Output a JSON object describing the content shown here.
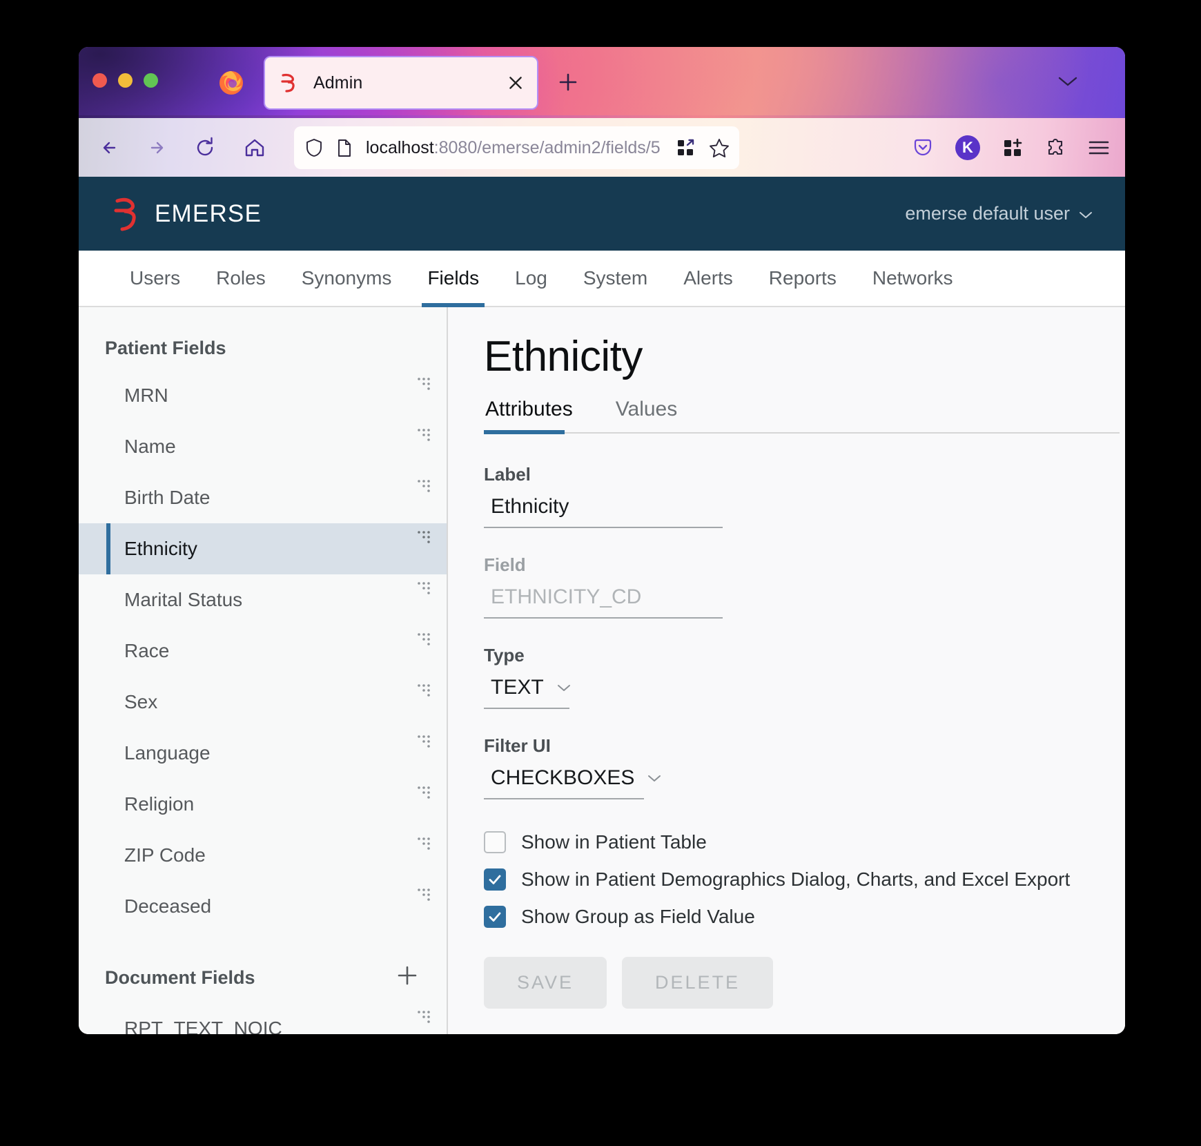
{
  "browser": {
    "tab": {
      "title": "Admin",
      "favicon": "emerse-logo-icon",
      "close_icon": "close-icon"
    },
    "new_tab_icon": "plus-icon",
    "tab_list_chevron_icon": "chevron-down-icon",
    "nav": {
      "back_icon": "arrow-left-icon",
      "forward_icon": "arrow-right-icon",
      "reload_icon": "reload-icon",
      "home_icon": "home-icon"
    },
    "url": {
      "shield_icon": "shield-icon",
      "page_icon": "page-icon",
      "host": "localhost",
      "path": ":8080/emerse/admin2/fields/5",
      "full": "localhost:8080/emerse/admin2/fields/5",
      "reader_icon": "grid-arrow-icon",
      "bookmark_icon": "star-icon"
    },
    "toolbar": {
      "pocket_icon": "pocket-icon",
      "account_initial": "K",
      "extensions_icon": "extensions-grid-icon",
      "puzzle_icon": "puzzle-icon",
      "menu_icon": "hamburger-menu-icon"
    },
    "window_controls": {
      "close": "close-window",
      "minimize": "minimize-window",
      "maximize": "maximize-window"
    },
    "firefox_icon": "firefox-logo-icon"
  },
  "app": {
    "brand": {
      "name": "EMERSE",
      "logo_icon": "emerse-logo-icon"
    },
    "user_menu": {
      "label": "emerse default user",
      "chevron_icon": "chevron-down-icon"
    },
    "nav_tabs": [
      {
        "label": "Users",
        "active": false
      },
      {
        "label": "Roles",
        "active": false
      },
      {
        "label": "Synonyms",
        "active": false
      },
      {
        "label": "Fields",
        "active": true
      },
      {
        "label": "Log",
        "active": false
      },
      {
        "label": "System",
        "active": false
      },
      {
        "label": "Alerts",
        "active": false
      },
      {
        "label": "Reports",
        "active": false
      },
      {
        "label": "Networks",
        "active": false
      }
    ]
  },
  "sidebar": {
    "patient_fields_heading": "Patient Fields",
    "patient_fields": [
      {
        "label": "MRN",
        "active": false
      },
      {
        "label": "Name",
        "active": false
      },
      {
        "label": "Birth Date",
        "active": false
      },
      {
        "label": "Ethnicity",
        "active": true
      },
      {
        "label": "Marital Status",
        "active": false
      },
      {
        "label": "Race",
        "active": false
      },
      {
        "label": "Sex",
        "active": false
      },
      {
        "label": "Language",
        "active": false
      },
      {
        "label": "Religion",
        "active": false
      },
      {
        "label": "ZIP Code",
        "active": false
      },
      {
        "label": "Deceased",
        "active": false
      }
    ],
    "document_fields_heading": "Document Fields",
    "document_fields_add_icon": "plus-icon",
    "document_fields": [
      {
        "label": "RPT_TEXT_NOIC",
        "active": false
      }
    ],
    "drag_handle_icon": "drag-handle-icon"
  },
  "detail": {
    "title": "Ethnicity",
    "sub_tabs": [
      {
        "label": "Attributes",
        "active": true
      },
      {
        "label": "Values",
        "active": false
      }
    ],
    "form": {
      "label_caption": "Label",
      "label_value": "Ethnicity",
      "field_caption": "Field",
      "field_placeholder": "ETHNICITY_CD",
      "type_caption": "Type",
      "type_value": "TEXT",
      "filter_ui_caption": "Filter UI",
      "filter_ui_value": "CHECKBOXES",
      "dropdown_icon": "chevron-down-icon"
    },
    "checkboxes": [
      {
        "label": "Show in Patient Table",
        "checked": false
      },
      {
        "label": "Show in Patient Demographics Dialog, Charts, and Excel Export",
        "checked": true
      },
      {
        "label": "Show Group as Field Value",
        "checked": true
      }
    ],
    "buttons": [
      {
        "label": "SAVE",
        "disabled": true
      },
      {
        "label": "DELETE",
        "disabled": true
      }
    ]
  },
  "colors": {
    "header_bg": "#163a51",
    "accent_blue": "#2f6e9e",
    "selected_row_bg": "#d8e0e8",
    "brand_red": "#e03131",
    "sidebar_bg": "#f8f9f9"
  }
}
